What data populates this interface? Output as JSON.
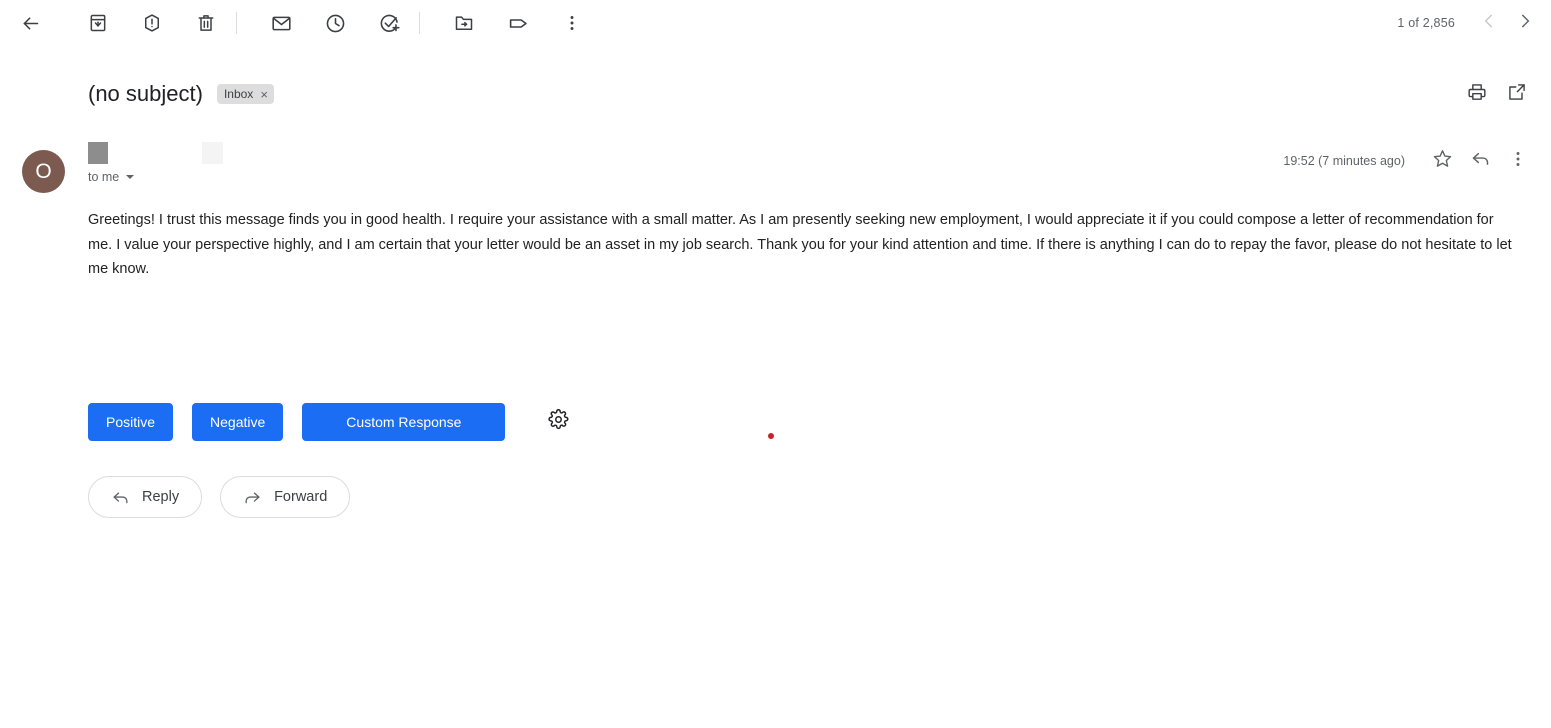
{
  "toolbar": {
    "items": [
      {
        "name": "back-to-inbox-icon",
        "label": "Back to Inbox"
      },
      {
        "name": "archive-icon",
        "label": "Archive"
      },
      {
        "name": "report-spam-icon",
        "label": "Report spam"
      },
      {
        "name": "delete-icon",
        "label": "Delete"
      },
      {
        "name": "mark-unread-icon",
        "label": "Mark as unread"
      },
      {
        "name": "snooze-icon",
        "label": "Snooze"
      },
      {
        "name": "add-to-tasks-icon",
        "label": "Add to tasks"
      },
      {
        "name": "move-to-icon",
        "label": "Move to"
      },
      {
        "name": "labels-icon",
        "label": "Labels"
      },
      {
        "name": "more-icon",
        "label": "More"
      }
    ],
    "pager": {
      "count_text": "1 of 2,856",
      "previous_label": "Older",
      "next_label": "Newer"
    }
  },
  "subject": {
    "title": "(no subject)",
    "label_chip": "Inbox",
    "label_chip_remove": "×",
    "print_label": "Print all",
    "popout_label": "Open in new window"
  },
  "message": {
    "avatar_initial": "O",
    "sender_name": "",
    "sender_email": "",
    "recipient": "to me",
    "timestamp": "19:52 (7 minutes ago)",
    "star_label": "Star",
    "reply_label": "Reply",
    "more_label": "More"
  },
  "body": {
    "text": "Greetings! I trust this message finds you in good health. I require your assistance with a small matter. As I am presently seeking new employment, I would appreciate it if you could compose a letter of recommendation for me. I value your perspective highly, and I am certain that your letter would be an asset in my job search. Thank you for your kind attention and time. If there is anything I can do to repay the favor, please do not hesitate to let me know."
  },
  "quick_response": {
    "positive_label": "Positive",
    "negative_label": "Negative",
    "custom_label": "Custom Response",
    "settings_label": "Settings",
    "accent_color": "#1b6ef3",
    "marker_color": "#cc2026"
  },
  "actions": {
    "reply_label": "Reply",
    "forward_label": "Forward"
  },
  "colors": {
    "avatar": "#7c5a50",
    "chip_background": "#ddddde",
    "text_primary": "#202124",
    "text_secondary": "#5f6368"
  }
}
